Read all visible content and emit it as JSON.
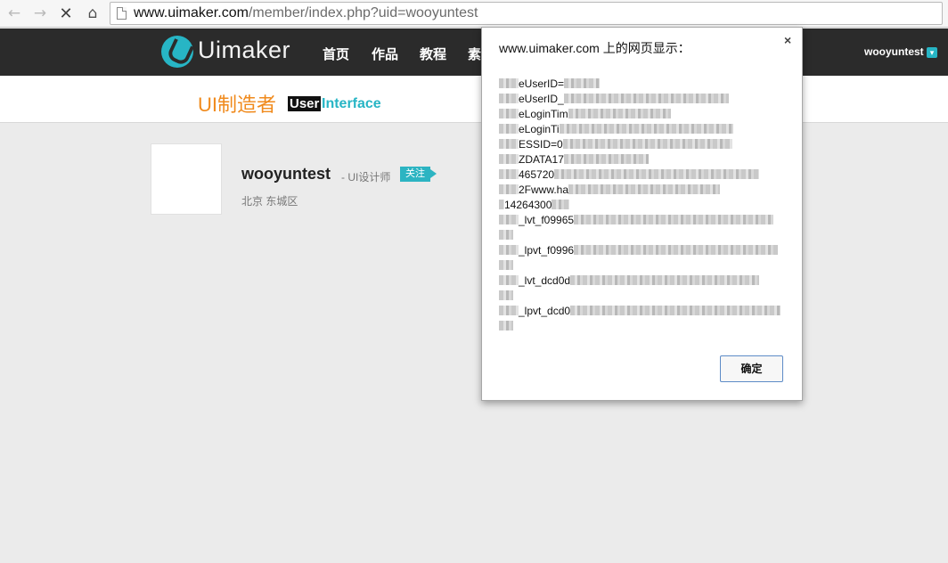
{
  "browser": {
    "back_icon": "←",
    "forward_icon": "→",
    "stop_icon": "✕",
    "home_icon": "⌂",
    "url_host": "www.uimaker.com",
    "url_path": "/member/index.php?uid=wooyuntest"
  },
  "site": {
    "logo_text": "Uimaker",
    "nav": [
      "首页",
      "作品",
      "教程",
      "素"
    ],
    "user_name": "wooyuntest",
    "user_menu_icon": "chevron-down-icon"
  },
  "banner": {
    "slogan": "UI制造者",
    "slogan_user": "User",
    "slogan_interface": "Interface"
  },
  "profile": {
    "name": "wooyuntest",
    "role": "- UI设计师",
    "follow_label": "关注",
    "location": "北京 东城区"
  },
  "dialog": {
    "title": "www.uimaker.com 上的网页显示：",
    "close_icon": "×",
    "cookies": [
      "eUserID=",
      "eUserID_",
      "eLoginTim",
      "eLoginTi",
      "ESSID=0",
      "ZDATA17",
      "465720",
      "2Fwww.ha",
      "14264300",
      "_lvt_f09965",
      "_lpvt_f0996",
      "_lvt_dcd0d",
      "_lpvt_dcd0"
    ],
    "ok_label": "确定"
  },
  "colors": {
    "accent": "#27b5c5",
    "header_bg": "#2b2b2b",
    "slogan": "#f08a1c"
  }
}
